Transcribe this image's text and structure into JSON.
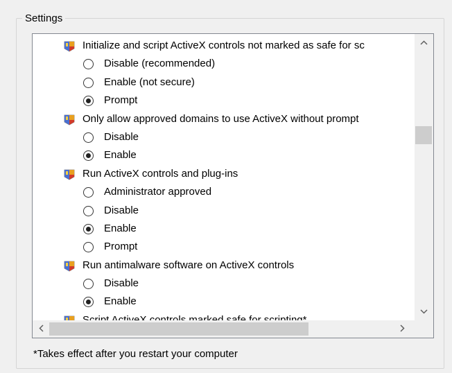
{
  "group": {
    "title": "Settings"
  },
  "settings": [
    {
      "type": "category",
      "icon": "shield-icon",
      "label": "Initialize and script ActiveX controls not marked as safe for sc"
    },
    {
      "type": "option",
      "label": "Disable (recommended)",
      "checked": false
    },
    {
      "type": "option",
      "label": "Enable (not secure)",
      "checked": false
    },
    {
      "type": "option",
      "label": "Prompt",
      "checked": true
    },
    {
      "type": "category",
      "icon": "shield-icon",
      "label": "Only allow approved domains to use ActiveX without prompt"
    },
    {
      "type": "option",
      "label": "Disable",
      "checked": false
    },
    {
      "type": "option",
      "label": "Enable",
      "checked": true
    },
    {
      "type": "category",
      "icon": "shield-icon",
      "label": "Run ActiveX controls and plug-ins"
    },
    {
      "type": "option",
      "label": "Administrator approved",
      "checked": false
    },
    {
      "type": "option",
      "label": "Disable",
      "checked": false
    },
    {
      "type": "option",
      "label": "Enable",
      "checked": true
    },
    {
      "type": "option",
      "label": "Prompt",
      "checked": false
    },
    {
      "type": "category",
      "icon": "shield-icon",
      "label": "Run antimalware software on ActiveX controls"
    },
    {
      "type": "option",
      "label": "Disable",
      "checked": false
    },
    {
      "type": "option",
      "label": "Enable",
      "checked": true
    },
    {
      "type": "category",
      "icon": "shield-icon",
      "label": "Script ActiveX controls marked safe for scripting*"
    }
  ],
  "scrollbars": {
    "vertical": {
      "up_icon": "chevron-up-icon",
      "down_icon": "chevron-down-icon"
    },
    "horizontal": {
      "left_icon": "chevron-left-icon",
      "right_icon": "chevron-right-icon"
    }
  },
  "footnote": "*Takes effect after you restart your computer"
}
